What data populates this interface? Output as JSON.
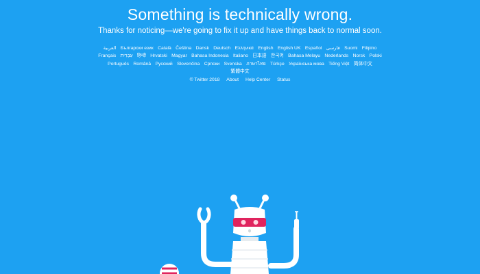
{
  "page": {
    "title": "Something is technically wrong.",
    "subtitle": "Thanks for noticing—we're going to fix it up and have things back to normal soon."
  },
  "languages": [
    "العربية",
    "Български език",
    "Català",
    "Čeština",
    "Dansk",
    "Deutsch",
    "Ελληνικά",
    "English",
    "English UK",
    "Español",
    "فارسی",
    "Suomi",
    "Filipino",
    "Français",
    "עִבְרִית",
    "हिन्दी",
    "Hrvatski",
    "Magyar",
    "Bahasa Indonesia",
    "Italiano",
    "日本語",
    "한국어",
    "Bahasa Melayu",
    "Nederlands",
    "Norsk",
    "Polski",
    "Português",
    "Română",
    "Русский",
    "Slovenčina",
    "Српски",
    "Svenska",
    "ภาษาไทย",
    "Türkçe",
    "Українська мова",
    "Tiếng Việt",
    "简体中文",
    "繁體中文"
  ],
  "footer": {
    "copyright": "© Twitter 2018",
    "about": "About",
    "help": "Help Center",
    "status": "Status"
  },
  "colors": {
    "background": "#1da1f2",
    "robot_body": "#ffffff",
    "robot_eyes": "#e0245e"
  },
  "illustration": {
    "robot": "robot-illustration",
    "tool": "screwdriver-icon"
  }
}
